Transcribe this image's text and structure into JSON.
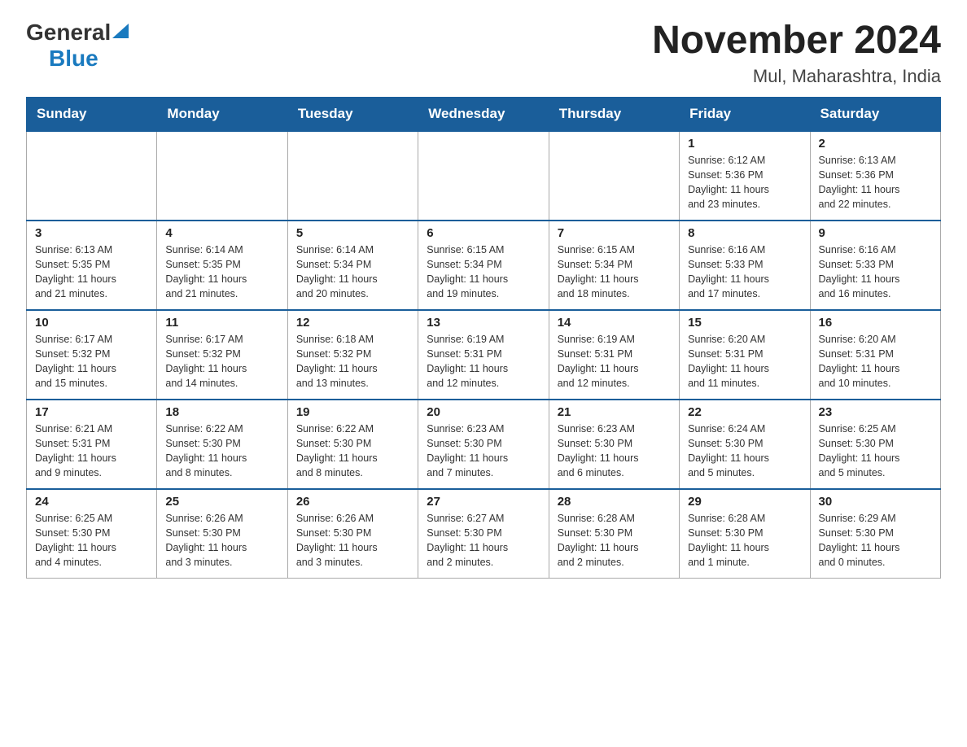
{
  "header": {
    "logo_general": "General",
    "logo_blue": "Blue",
    "month_year": "November 2024",
    "location": "Mul, Maharashtra, India"
  },
  "weekdays": [
    "Sunday",
    "Monday",
    "Tuesday",
    "Wednesday",
    "Thursday",
    "Friday",
    "Saturday"
  ],
  "weeks": [
    {
      "days": [
        {
          "number": "",
          "info": ""
        },
        {
          "number": "",
          "info": ""
        },
        {
          "number": "",
          "info": ""
        },
        {
          "number": "",
          "info": ""
        },
        {
          "number": "",
          "info": ""
        },
        {
          "number": "1",
          "info": "Sunrise: 6:12 AM\nSunset: 5:36 PM\nDaylight: 11 hours\nand 23 minutes."
        },
        {
          "number": "2",
          "info": "Sunrise: 6:13 AM\nSunset: 5:36 PM\nDaylight: 11 hours\nand 22 minutes."
        }
      ]
    },
    {
      "days": [
        {
          "number": "3",
          "info": "Sunrise: 6:13 AM\nSunset: 5:35 PM\nDaylight: 11 hours\nand 21 minutes."
        },
        {
          "number": "4",
          "info": "Sunrise: 6:14 AM\nSunset: 5:35 PM\nDaylight: 11 hours\nand 21 minutes."
        },
        {
          "number": "5",
          "info": "Sunrise: 6:14 AM\nSunset: 5:34 PM\nDaylight: 11 hours\nand 20 minutes."
        },
        {
          "number": "6",
          "info": "Sunrise: 6:15 AM\nSunset: 5:34 PM\nDaylight: 11 hours\nand 19 minutes."
        },
        {
          "number": "7",
          "info": "Sunrise: 6:15 AM\nSunset: 5:34 PM\nDaylight: 11 hours\nand 18 minutes."
        },
        {
          "number": "8",
          "info": "Sunrise: 6:16 AM\nSunset: 5:33 PM\nDaylight: 11 hours\nand 17 minutes."
        },
        {
          "number": "9",
          "info": "Sunrise: 6:16 AM\nSunset: 5:33 PM\nDaylight: 11 hours\nand 16 minutes."
        }
      ]
    },
    {
      "days": [
        {
          "number": "10",
          "info": "Sunrise: 6:17 AM\nSunset: 5:32 PM\nDaylight: 11 hours\nand 15 minutes."
        },
        {
          "number": "11",
          "info": "Sunrise: 6:17 AM\nSunset: 5:32 PM\nDaylight: 11 hours\nand 14 minutes."
        },
        {
          "number": "12",
          "info": "Sunrise: 6:18 AM\nSunset: 5:32 PM\nDaylight: 11 hours\nand 13 minutes."
        },
        {
          "number": "13",
          "info": "Sunrise: 6:19 AM\nSunset: 5:31 PM\nDaylight: 11 hours\nand 12 minutes."
        },
        {
          "number": "14",
          "info": "Sunrise: 6:19 AM\nSunset: 5:31 PM\nDaylight: 11 hours\nand 12 minutes."
        },
        {
          "number": "15",
          "info": "Sunrise: 6:20 AM\nSunset: 5:31 PM\nDaylight: 11 hours\nand 11 minutes."
        },
        {
          "number": "16",
          "info": "Sunrise: 6:20 AM\nSunset: 5:31 PM\nDaylight: 11 hours\nand 10 minutes."
        }
      ]
    },
    {
      "days": [
        {
          "number": "17",
          "info": "Sunrise: 6:21 AM\nSunset: 5:31 PM\nDaylight: 11 hours\nand 9 minutes."
        },
        {
          "number": "18",
          "info": "Sunrise: 6:22 AM\nSunset: 5:30 PM\nDaylight: 11 hours\nand 8 minutes."
        },
        {
          "number": "19",
          "info": "Sunrise: 6:22 AM\nSunset: 5:30 PM\nDaylight: 11 hours\nand 8 minutes."
        },
        {
          "number": "20",
          "info": "Sunrise: 6:23 AM\nSunset: 5:30 PM\nDaylight: 11 hours\nand 7 minutes."
        },
        {
          "number": "21",
          "info": "Sunrise: 6:23 AM\nSunset: 5:30 PM\nDaylight: 11 hours\nand 6 minutes."
        },
        {
          "number": "22",
          "info": "Sunrise: 6:24 AM\nSunset: 5:30 PM\nDaylight: 11 hours\nand 5 minutes."
        },
        {
          "number": "23",
          "info": "Sunrise: 6:25 AM\nSunset: 5:30 PM\nDaylight: 11 hours\nand 5 minutes."
        }
      ]
    },
    {
      "days": [
        {
          "number": "24",
          "info": "Sunrise: 6:25 AM\nSunset: 5:30 PM\nDaylight: 11 hours\nand 4 minutes."
        },
        {
          "number": "25",
          "info": "Sunrise: 6:26 AM\nSunset: 5:30 PM\nDaylight: 11 hours\nand 3 minutes."
        },
        {
          "number": "26",
          "info": "Sunrise: 6:26 AM\nSunset: 5:30 PM\nDaylight: 11 hours\nand 3 minutes."
        },
        {
          "number": "27",
          "info": "Sunrise: 6:27 AM\nSunset: 5:30 PM\nDaylight: 11 hours\nand 2 minutes."
        },
        {
          "number": "28",
          "info": "Sunrise: 6:28 AM\nSunset: 5:30 PM\nDaylight: 11 hours\nand 2 minutes."
        },
        {
          "number": "29",
          "info": "Sunrise: 6:28 AM\nSunset: 5:30 PM\nDaylight: 11 hours\nand 1 minute."
        },
        {
          "number": "30",
          "info": "Sunrise: 6:29 AM\nSunset: 5:30 PM\nDaylight: 11 hours\nand 0 minutes."
        }
      ]
    }
  ]
}
